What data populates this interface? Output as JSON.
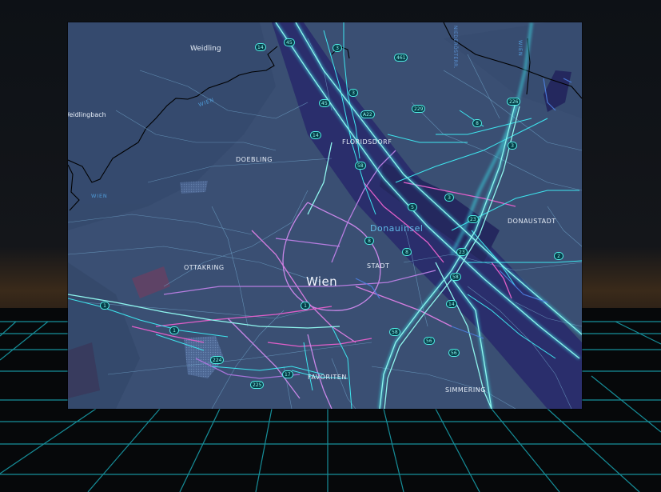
{
  "colors": {
    "map_bg": "#3a4f73",
    "major_road": "#3ee6ef",
    "highway_glow": "#8ff6ee",
    "secondary_road": "#c987e8",
    "pink_road": "#e15fc9",
    "water": "#2b2f6e",
    "border": "#000000",
    "grid": "#19a6b3"
  },
  "map": {
    "city_label": "Wien",
    "water_label": "Donauinsel",
    "districts": {
      "weidling": "Weidling",
      "weidlingbach": "Weidlingbach",
      "floridsdorf": "FLORIDSDORF",
      "doebling": "DOEBLING",
      "donaustadt": "DONAUSTADT",
      "ottakring": "OTTAKRING",
      "stadt": "STADT",
      "favoriten": "FAVORITEN",
      "simmering": "SIMMERING"
    },
    "border_labels": [
      "WIEN",
      "WIEN",
      "WIEN"
    ],
    "street_labels": [
      "NIEDERÖSTERR."
    ],
    "shields": [
      "14",
      "45",
      "3",
      "461",
      "3",
      "45",
      "A22",
      "229",
      "8",
      "226",
      "14",
      "3",
      "58",
      "3",
      "5",
      "8",
      "23",
      "8",
      "14",
      "23",
      "2",
      "1",
      "1",
      "1",
      "224",
      "17",
      "225",
      "58",
      "56",
      "56",
      "14",
      "58"
    ]
  }
}
